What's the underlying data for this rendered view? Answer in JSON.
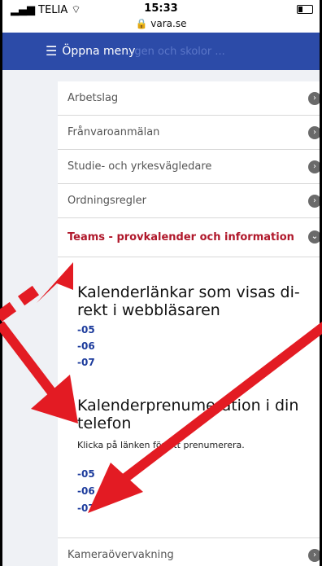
{
  "status_bar": {
    "carrier": "TELIA",
    "time": "15:33",
    "domain": "vara.se"
  },
  "header": {
    "menu_label": "Öppna meny",
    "ghost_text": "...gen och skolor ..."
  },
  "accordion": [
    {
      "label": "Arbetslag",
      "expanded": false
    },
    {
      "label": "Frånvaroanmälan",
      "expanded": false
    },
    {
      "label": "Studie- och yrkesvägledare",
      "expanded": false
    },
    {
      "label": "Ordningsregler",
      "expanded": false
    },
    {
      "label": "Teams - provkalender och information",
      "expanded": true
    },
    {
      "label": "Kameraövervakning",
      "expanded": false
    }
  ],
  "content": {
    "section1_title_line1": "Kalenderlänkar som visas di-",
    "section1_title_line2": "rekt i webbläsaren",
    "section1_links": [
      "-05",
      "-06",
      "-07"
    ],
    "section2_title_line1": "Kalenderprenumeration i din",
    "section2_title_line2": "telefon",
    "section2_instruction": "Klicka på länken för att prenumerera.",
    "section2_links": [
      "-05",
      "-06",
      "-07"
    ]
  },
  "colors": {
    "header_blue": "#2c4ba8",
    "active_red": "#b0182b",
    "link_blue": "#1c3b9c",
    "arrow_red": "#e31b23"
  },
  "icons": {
    "menu": "hamburger-icon",
    "chevron": "chevron-right-icon",
    "chevron_open": "chevron-down-icon"
  }
}
